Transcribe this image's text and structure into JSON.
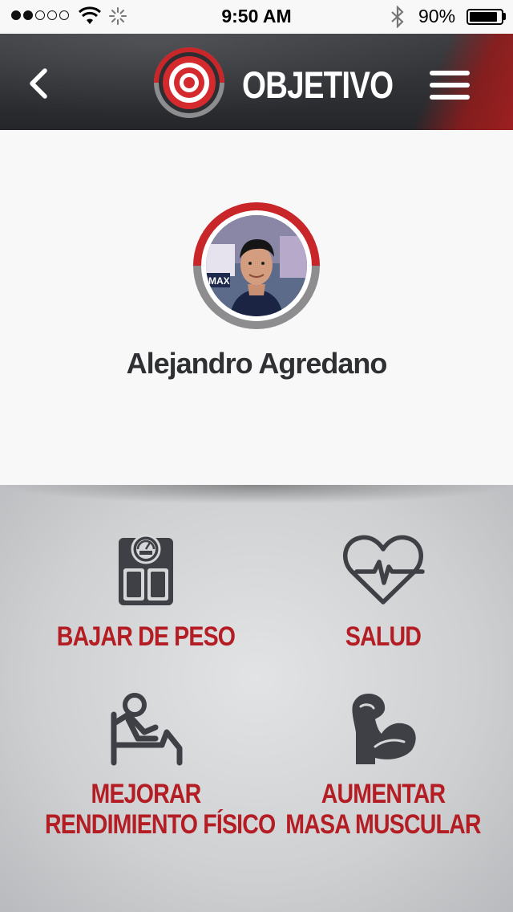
{
  "status_bar": {
    "time": "9:50 AM",
    "battery_percent": "90%",
    "battery_level": 0.9,
    "signal_dots_filled": 2,
    "signal_dots_total": 5
  },
  "header": {
    "title": "OBJETIVO",
    "back_icon": "chevron-left-icon",
    "logo_icon": "target-icon",
    "menu_icon": "hamburger-menu-icon"
  },
  "profile": {
    "name": "Alejandro Agredano"
  },
  "goals": [
    {
      "label": "BAJAR DE PESO",
      "icon": "scale-icon"
    },
    {
      "label": "SALUD",
      "icon": "heartbeat-icon"
    },
    {
      "label_line1": "MEJORAR",
      "label_line2": "RENDIMIENTO FÍSICO",
      "icon": "exercise-icon"
    },
    {
      "label_line1": "AUMENTAR",
      "label_line2": "MASA MUSCULAR",
      "icon": "muscle-icon"
    }
  ],
  "colors": {
    "accent_red": "#b31d23",
    "icon_gray": "#3e4045",
    "header_dark": "#2a2c30"
  }
}
